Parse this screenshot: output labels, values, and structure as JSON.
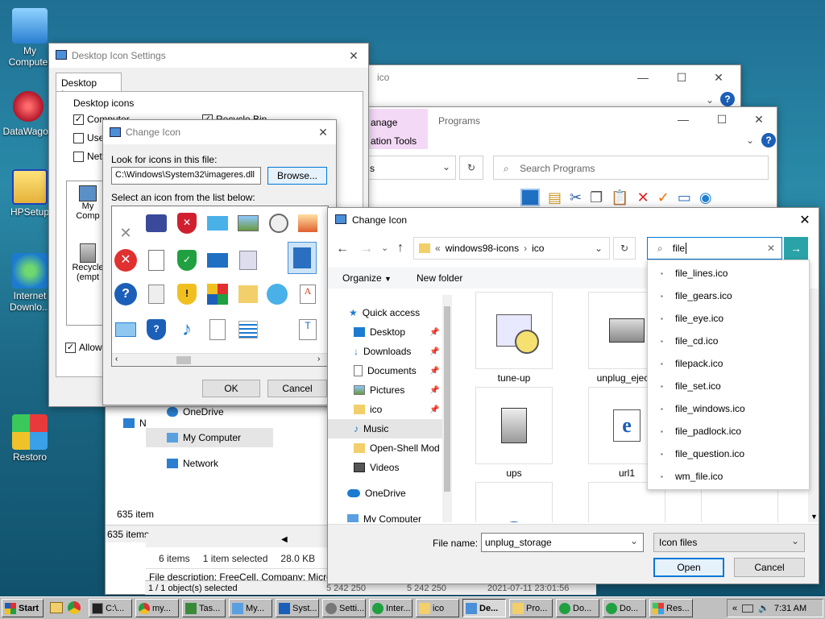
{
  "desktop": {
    "icons": [
      {
        "label": "My Computer"
      },
      {
        "label": "DataWagon"
      },
      {
        "label": "HPSetup"
      },
      {
        "label": "Internet Downlo..."
      },
      {
        "label": "Restoro"
      }
    ]
  },
  "desktop_icon_settings": {
    "title": "Desktop Icon Settings",
    "tab": "Desktop Icons",
    "group_label": "Desktop icons",
    "checks": [
      {
        "label": "Computer",
        "checked": true
      },
      {
        "label": "Recycle Bin",
        "checked": true
      },
      {
        "label": "User",
        "checked": false
      },
      {
        "label": "Netw",
        "checked": false
      }
    ],
    "preview_icons": [
      "My Comp",
      "Recycle",
      "(empt"
    ],
    "allow_label": "Allow t"
  },
  "change_icon_small": {
    "title": "Change Icon",
    "look_label": "Look for icons in this file:",
    "path_value": "C:\\Windows\\System32\\imageres.dll",
    "browse_label": "Browse...",
    "select_label": "Select an icon from the list below:",
    "ok_label": "OK",
    "cancel_label": "Cancel"
  },
  "explorer_ico": {
    "title": "ico"
  },
  "explorer_programs": {
    "ribbon_tab_manage": "anage",
    "ribbon_tab_programs": "Programs",
    "ribbon_sub": "ation Tools",
    "address_partial": "s",
    "search_placeholder": "Search Programs"
  },
  "explorer_back": {
    "nav": [
      "N",
      "OneDrive",
      "My Computer",
      "Network"
    ],
    "items_count_1": "635 item",
    "items_count_2": "635 items",
    "status_items": "6 items",
    "status_selected": "1 item selected",
    "status_size": "28.0 KB",
    "file_desc": "File description: FreeCell, Company: Micro",
    "bottom_selected": "1 / 1 object(s) selected",
    "bottom_nums": [
      "5 242 250",
      "5 242 250",
      "2021-07-11 23:01:56"
    ]
  },
  "change_icon_dialog": {
    "title": "Change Icon",
    "breadcrumb": [
      "windows98-icons",
      "ico"
    ],
    "search_value": "file",
    "organize_label": "Organize",
    "new_folder_label": "New folder",
    "nav": [
      {
        "label": "Quick access",
        "icon": "star-icon"
      },
      {
        "label": "Desktop",
        "icon": "desktop-icon",
        "pinned": true
      },
      {
        "label": "Downloads",
        "icon": "download-icon",
        "pinned": true
      },
      {
        "label": "Documents",
        "icon": "documents-icon",
        "pinned": true
      },
      {
        "label": "Pictures",
        "icon": "pictures-icon",
        "pinned": true
      },
      {
        "label": "ico",
        "icon": "folder-icon",
        "pinned": true
      },
      {
        "label": "Music",
        "icon": "music-icon"
      },
      {
        "label": "Open-Shell Mod",
        "icon": "folder-icon"
      },
      {
        "label": "Videos",
        "icon": "videos-icon"
      },
      {
        "label": "OneDrive",
        "icon": "onedrive-icon"
      },
      {
        "label": "My Computer",
        "icon": "computer-icon"
      }
    ],
    "files": [
      {
        "label": "tune-up"
      },
      {
        "label": "unplug_eject_"
      },
      {
        "label": "ups"
      },
      {
        "label": "url1"
      },
      {
        "label": ""
      },
      {
        "label": ""
      },
      {
        "label": ""
      }
    ],
    "suggestions": [
      "file_lines.ico",
      "file_gears.ico",
      "file_eye.ico",
      "file_cd.ico",
      "filepack.ico",
      "file_set.ico",
      "file_windows.ico",
      "file_padlock.ico",
      "file_question.ico",
      "wm_file.ico"
    ],
    "file_name_label": "File name:",
    "file_name_value": "unplug_storage",
    "file_type_value": "Icon files",
    "open_label": "Open",
    "cancel_label": "Cancel"
  },
  "taskbar": {
    "start_label": "Start",
    "items": [
      "C:\\...",
      "my...",
      "Tas...",
      "My...",
      "Syst...",
      "Setti...",
      "Inter...",
      "ico",
      "De...",
      "Pro...",
      "Do...",
      "Do...",
      "Res..."
    ],
    "clock": "7:31 AM",
    "tray_arrows": "«"
  }
}
